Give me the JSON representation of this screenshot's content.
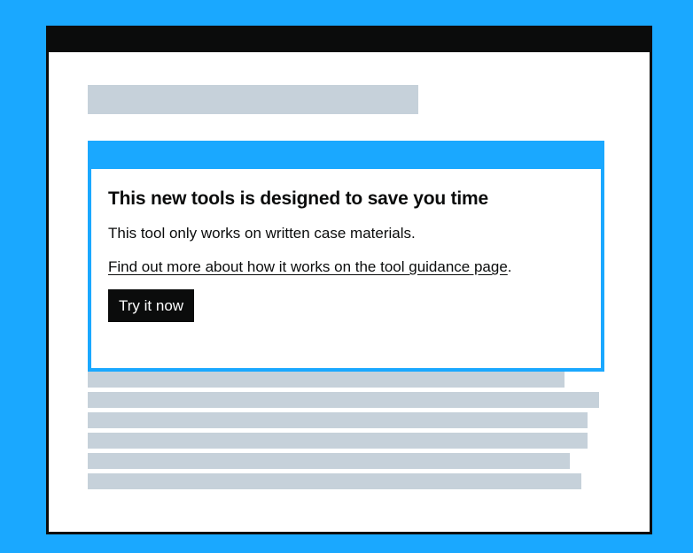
{
  "banner": {
    "title": "This new tools is designed to save you time",
    "body": "This tool only works on written case materials.",
    "link_text": "Find out more about how it works on the tool guidance page",
    "link_suffix": ".",
    "button_label": "Try it now"
  },
  "colors": {
    "background": "#1aa8ff",
    "window_border": "#0b0c0c",
    "placeholder": "#c6d1da",
    "banner_accent": "#1aa8ff",
    "button_bg": "#0b0c0c",
    "button_text": "#ffffff"
  }
}
